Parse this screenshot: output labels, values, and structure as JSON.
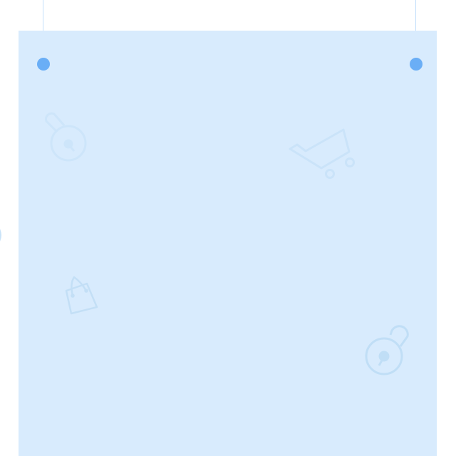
{
  "colors": {
    "background": "#ffffff",
    "panel": "#d8ebfd",
    "pin": "#6aaef6",
    "string": "#c4e0fb",
    "icon_faint": "#cde5fa",
    "icon": "#c2e0f7"
  },
  "decorations": [
    "padlock-icon",
    "shopping-cart-icon",
    "shopping-bag-icon",
    "unlocked-padlock-icon"
  ]
}
